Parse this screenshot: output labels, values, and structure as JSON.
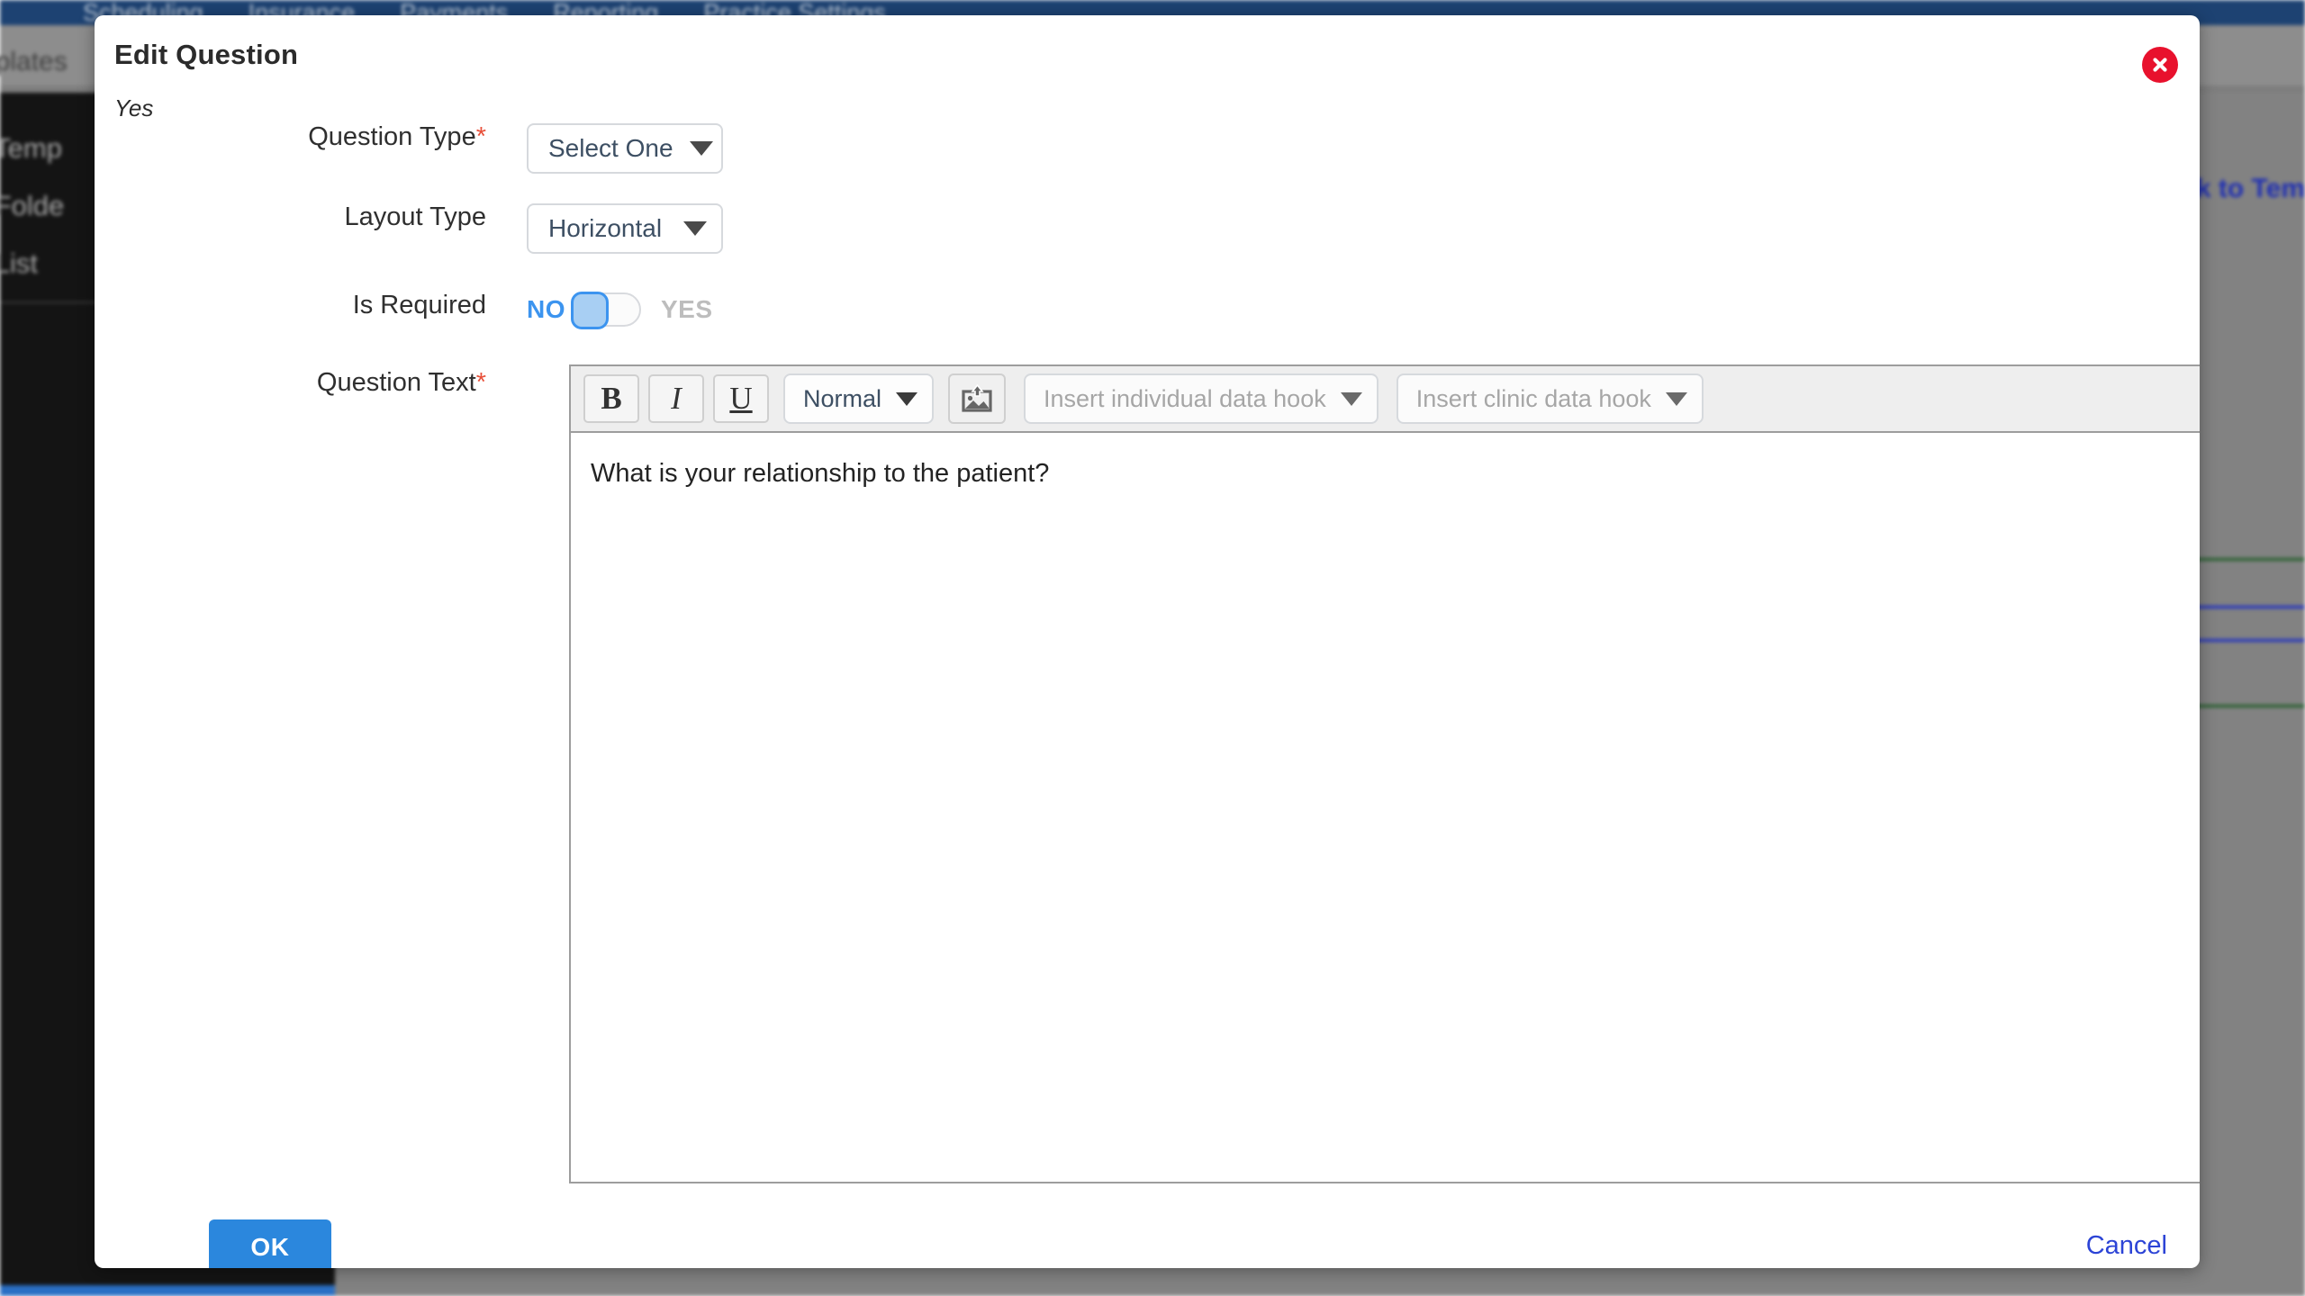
{
  "background": {
    "topnav": [
      "Scheduling",
      "Insurance",
      "Payments",
      "Reporting",
      "Practice Settings"
    ],
    "tab_label": "Templates",
    "sidebar_items": [
      "ent Temp",
      "ate Folde",
      "ate List"
    ],
    "back_link": "ck to Tem",
    "rule_colors": [
      "#1d5c26",
      "#1a2bc4",
      "#1a2bc4",
      "#1d5c26"
    ]
  },
  "modal": {
    "title": "Edit Question",
    "subtitle": "Yes",
    "close_icon": "close-circle-icon",
    "fields": {
      "question_type": {
        "label": "Question Type",
        "required": true,
        "value": "Select One"
      },
      "layout_type": {
        "label": "Layout Type",
        "required": false,
        "value": "Horizontal"
      },
      "is_required": {
        "label": "Is Required",
        "off_label": "NO",
        "on_label": "YES",
        "state": "off"
      },
      "question_text": {
        "label": "Question Text",
        "required": true,
        "value": "What is your relationship to the patient?"
      }
    },
    "editor_toolbar": {
      "bold": "B",
      "italic": "I",
      "underline": "U",
      "style_select": "Normal",
      "image_icon": "insert-image-icon",
      "individual_hook": "Insert individual data hook",
      "clinic_hook": "Insert clinic data hook"
    },
    "footer": {
      "ok_label": "OK",
      "cancel_label": "Cancel"
    }
  },
  "colors": {
    "primary_button": "#2b87dd",
    "close_button": "#e8112d",
    "toggle_active": "#3c94ef",
    "link": "#2c44d6",
    "required_star": "#e8503a",
    "topnav": "#1d4272"
  }
}
